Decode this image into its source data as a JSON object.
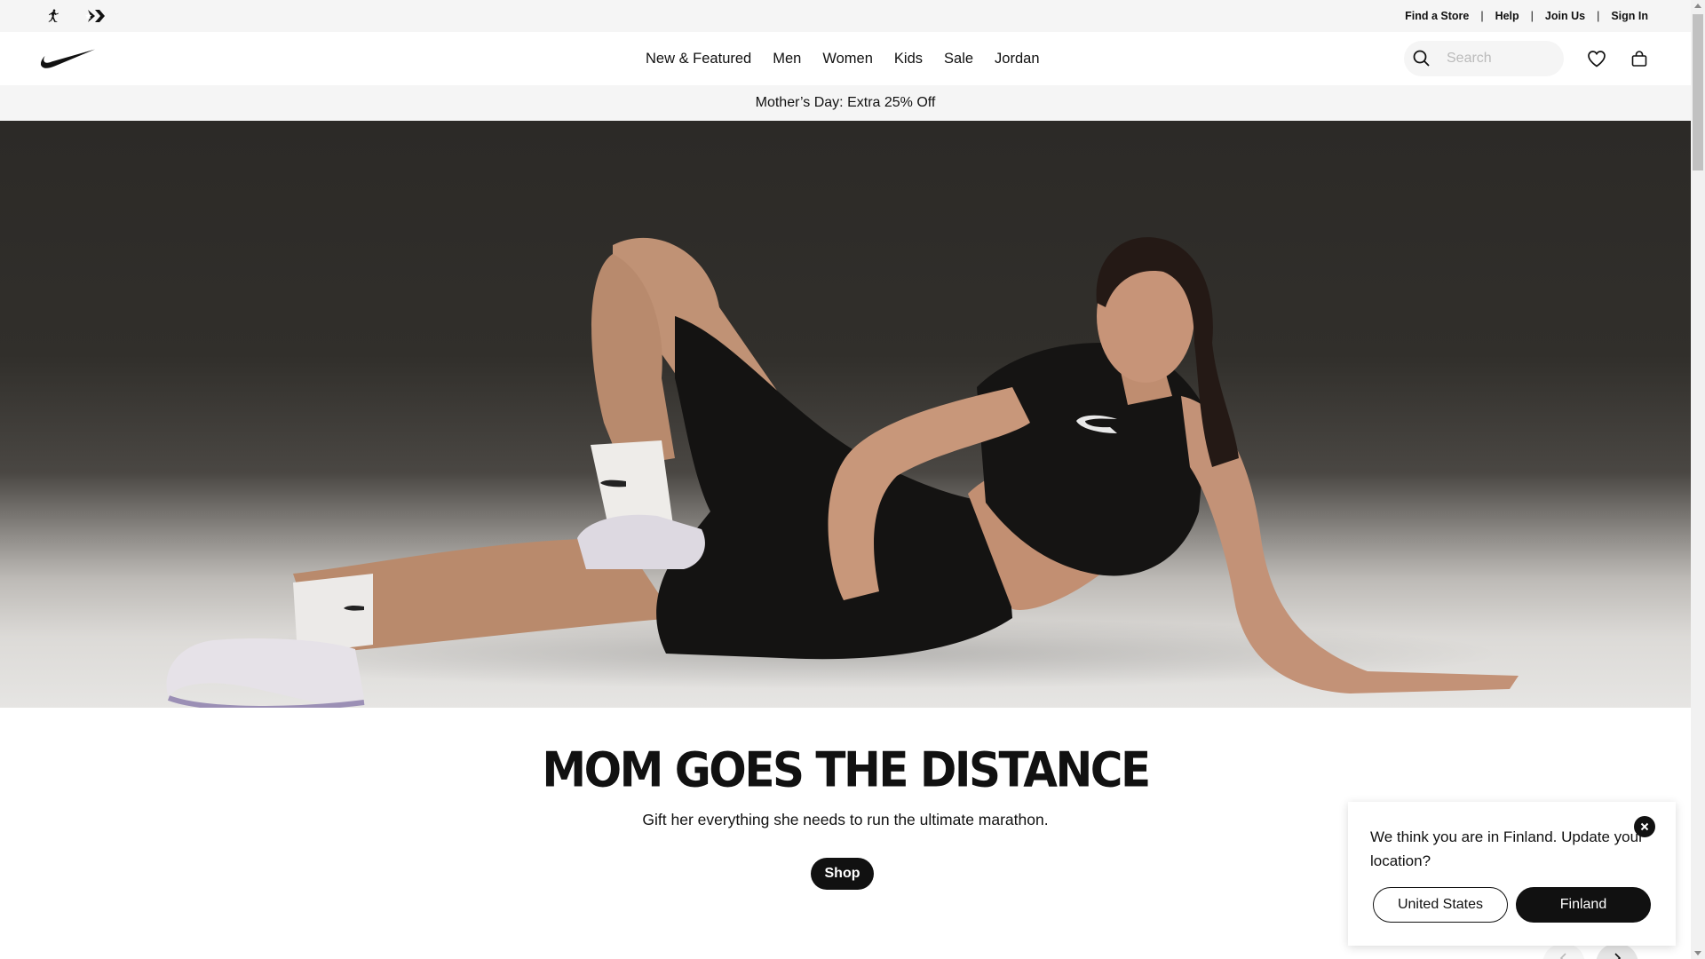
{
  "utility_bar": {
    "brand_icons": [
      "jordan-jumpman-icon",
      "converse-icon"
    ],
    "links": [
      "Find a Store",
      "Help",
      "Join Us",
      "Sign In"
    ],
    "separator": "|"
  },
  "nav": {
    "logo": "nike-swoosh-icon",
    "menu": [
      "New & Featured",
      "Men",
      "Women",
      "Kids",
      "Sale",
      "Jordan"
    ],
    "search_placeholder": "Search",
    "icons": [
      "search-icon",
      "heart-icon",
      "bag-icon"
    ]
  },
  "promo": {
    "text": "Mother’s Day: Extra 25% Off"
  },
  "hero": {
    "headline": "MOM GOES THE DISTANCE",
    "subline": "Gift her everything she needs to run the ultimate marathon.",
    "cta": "Shop"
  },
  "location_modal": {
    "message": "We think you are in Finland. Update your location?",
    "option_1": "United States",
    "option_2": "Finland"
  },
  "carousel": {
    "icons": [
      "chevron-left-icon",
      "chevron-right-icon"
    ]
  },
  "colors": {
    "text": "#111111",
    "utility_bg": "#f5f5f5",
    "button": "#111111"
  }
}
